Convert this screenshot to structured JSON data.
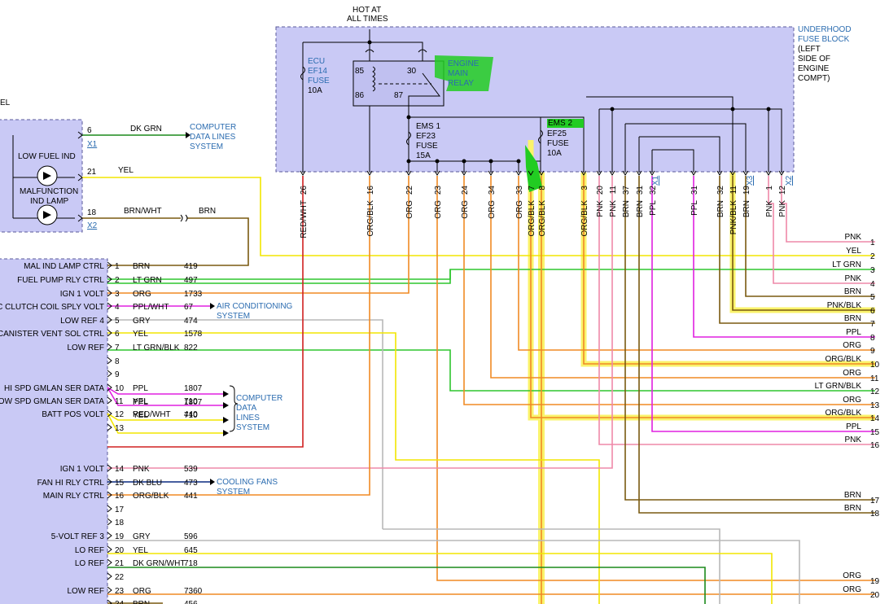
{
  "header": {
    "hot_line1": "HOT AT",
    "hot_line2": "ALL TIMES"
  },
  "fuse_block": {
    "title": [
      "UNDERHOOD",
      "FUSE BLOCK"
    ],
    "note": [
      "(LEFT",
      "SIDE OF",
      "ENGINE",
      "COMPT)"
    ]
  },
  "fuses": {
    "ecu": [
      "ECU",
      "EF14",
      "FUSE"
    ],
    "ecu_rating": "10A",
    "ems1": [
      "EMS 1",
      "EF23",
      "FUSE",
      "15A"
    ],
    "ems2": [
      "EMS 2",
      "EF25",
      "FUSE",
      "10A"
    ]
  },
  "relay": {
    "label": [
      "ENGINE",
      "MAIN",
      "RELAY"
    ],
    "pins": [
      "85",
      "30",
      "86",
      "87"
    ]
  },
  "left_lamp": {
    "el_partial": "EL",
    "low_fuel": "LOW FUEL IND",
    "mil": [
      "MALFUNCTION",
      "IND LAMP"
    ],
    "pins": [
      {
        "pin": "6",
        "wire": "DK GRN",
        "conn": "X1",
        "dest": [
          "COMPUTER",
          "DATA LINES",
          "SYSTEM"
        ]
      },
      {
        "pin": "21",
        "wire": "YEL"
      },
      {
        "pin": "18",
        "wire": "BRN/WHT",
        "wire2": "BRN",
        "conn": "X2"
      }
    ]
  },
  "top_pins": [
    {
      "pin": "26",
      "color": "RED/WHT"
    },
    {
      "pin": "16",
      "color": "ORG/BLK"
    },
    {
      "pin": "22",
      "color": "ORG"
    },
    {
      "pin": "23",
      "color": "ORG"
    },
    {
      "pin": "24",
      "color": "ORG"
    },
    {
      "pin": "34",
      "color": "ORG"
    },
    {
      "pin": "33",
      "color": "ORG"
    },
    {
      "pin": "7",
      "color": "ORG/BLK"
    },
    {
      "pin": "8",
      "color": "ORG/BLK"
    },
    {
      "pin": "3",
      "color": "ORG/BLK"
    },
    {
      "pin": "20",
      "color": "PNK"
    },
    {
      "pin": "11",
      "color": "PNK"
    },
    {
      "pin": "37",
      "color": "BRN"
    },
    {
      "pin": "31",
      "color": "BRN"
    },
    {
      "pin": "32",
      "color": "PPL"
    },
    {
      "pin": "X1",
      "color": ""
    },
    {
      "pin": "31",
      "color": "PPL"
    },
    {
      "pin": "32",
      "color": "BRN"
    },
    {
      "pin": "11",
      "color": "PNK/BLK"
    },
    {
      "pin": "19",
      "color": "BRN"
    },
    {
      "pin": "X3",
      "color": ""
    },
    {
      "pin": "1",
      "color": "PNK"
    },
    {
      "pin": "12",
      "color": "PNK"
    },
    {
      "pin": "X2",
      "color": ""
    }
  ],
  "ecm_pins": [
    {
      "pin": "1",
      "name": "MAL IND LAMP CTRL",
      "wire": "BRN",
      "circuit": "419"
    },
    {
      "pin": "2",
      "name": "FUEL PUMP RLY CTRL",
      "wire": "LT GRN",
      "circuit": "497"
    },
    {
      "pin": "3",
      "name": "IGN 1 VOLT",
      "wire": "ORG",
      "circuit": "1733"
    },
    {
      "pin": "4",
      "name": "C CLUTCH COIL SPLY VOLT",
      "wire": "PPL/WHT",
      "circuit": "67"
    },
    {
      "pin": "5",
      "name": "LOW REF 4",
      "wire": "GRY",
      "circuit": "474"
    },
    {
      "pin": "6",
      "name": "CANISTER VENT SOL CTRL",
      "wire": "YEL",
      "circuit": "1578"
    },
    {
      "pin": "7",
      "name": "LOW REF",
      "wire": "LT GRN/BLK",
      "circuit": "822"
    },
    {
      "pin": "8",
      "name": "",
      "wire": "",
      "circuit": ""
    },
    {
      "pin": "9",
      "name": "",
      "wire": "",
      "circuit": ""
    },
    {
      "pin": "10",
      "name": "HI SPD GMLAN SER DATA",
      "wire": "PPL",
      "circuit": "1807",
      "wire2": "PPL",
      "circuit2": "1807"
    },
    {
      "pin": "11",
      "name": "OW SPD GMLAN SER DATA",
      "wire": "YEL",
      "circuit": "710",
      "wire2": "YEL",
      "circuit2": "710"
    },
    {
      "pin": "12",
      "name": "BATT POS VOLT",
      "wire": "RED/WHT",
      "circuit": "440"
    },
    {
      "pin": "13",
      "name": "",
      "wire": "",
      "circuit": ""
    },
    {
      "pin": "14",
      "name": "IGN 1 VOLT",
      "wire": "PNK",
      "circuit": "539"
    },
    {
      "pin": "15",
      "name": "FAN HI RLY CTRL",
      "wire": "DK BLU",
      "circuit": "473"
    },
    {
      "pin": "16",
      "name": "MAIN RLY CTRL",
      "wire": "ORG/BLK",
      "circuit": "441"
    },
    {
      "pin": "17",
      "name": "",
      "wire": "",
      "circuit": ""
    },
    {
      "pin": "18",
      "name": "",
      "wire": "",
      "circuit": ""
    },
    {
      "pin": "19",
      "name": "5-VOLT REF 3",
      "wire": "GRY",
      "circuit": "596"
    },
    {
      "pin": "20",
      "name": "LO REF",
      "wire": "YEL",
      "circuit": "645"
    },
    {
      "pin": "21",
      "name": "LO REF",
      "wire": "DK GRN/WHT",
      "circuit": "718"
    },
    {
      "pin": "22",
      "name": "",
      "wire": "",
      "circuit": ""
    },
    {
      "pin": "23",
      "name": "LOW REF",
      "wire": "ORG",
      "circuit": "7360"
    },
    {
      "pin": "24",
      "name": "",
      "wire": "BRN",
      "circuit": "456"
    }
  ],
  "side_systems": {
    "ac": [
      "AIR CONDITIONING",
      "SYSTEM"
    ],
    "data": [
      "COMPUTER",
      "DATA",
      "LINES",
      "SYSTEM"
    ],
    "fans": [
      "COOLING FANS",
      "SYSTEM"
    ]
  },
  "right_pins": [
    {
      "pin": "1",
      "color": "PNK"
    },
    {
      "pin": "2",
      "color": "YEL"
    },
    {
      "pin": "3",
      "color": "LT GRN"
    },
    {
      "pin": "4",
      "color": "PNK"
    },
    {
      "pin": "5",
      "color": "BRN"
    },
    {
      "pin": "6",
      "color": "PNK/BLK"
    },
    {
      "pin": "7",
      "color": "BRN"
    },
    {
      "pin": "8",
      "color": "PPL"
    },
    {
      "pin": "9",
      "color": "ORG"
    },
    {
      "pin": "10",
      "color": "ORG/BLK"
    },
    {
      "pin": "11",
      "color": "ORG"
    },
    {
      "pin": "12",
      "color": "LT GRN/BLK"
    },
    {
      "pin": "13",
      "color": "ORG"
    },
    {
      "pin": "14",
      "color": "ORG/BLK"
    },
    {
      "pin": "15",
      "color": "PPL"
    },
    {
      "pin": "16",
      "color": "PNK"
    },
    {
      "pin": "17",
      "color": "BRN"
    },
    {
      "pin": "18",
      "color": "BRN"
    },
    {
      "pin": "19",
      "color": "ORG"
    },
    {
      "pin": "20",
      "color": "ORG"
    }
  ],
  "colors": {
    "box_fill": "#c9c9f5",
    "box_border": "#5a5a9a",
    "label_blue": "#2b6cb0",
    "yellow": "#f2e600",
    "orange": "#f08a24",
    "green": "#2ec52e",
    "pink": "#ee88a8",
    "brown": "#7a5a10",
    "purple": "#e020e0",
    "gray": "#b8b8b8",
    "red": "#d02020",
    "dkgreen": "#1c8a1c",
    "dkblue": "#0a2a80",
    "highlight": "#faf36a",
    "marker": "#22cc22"
  }
}
